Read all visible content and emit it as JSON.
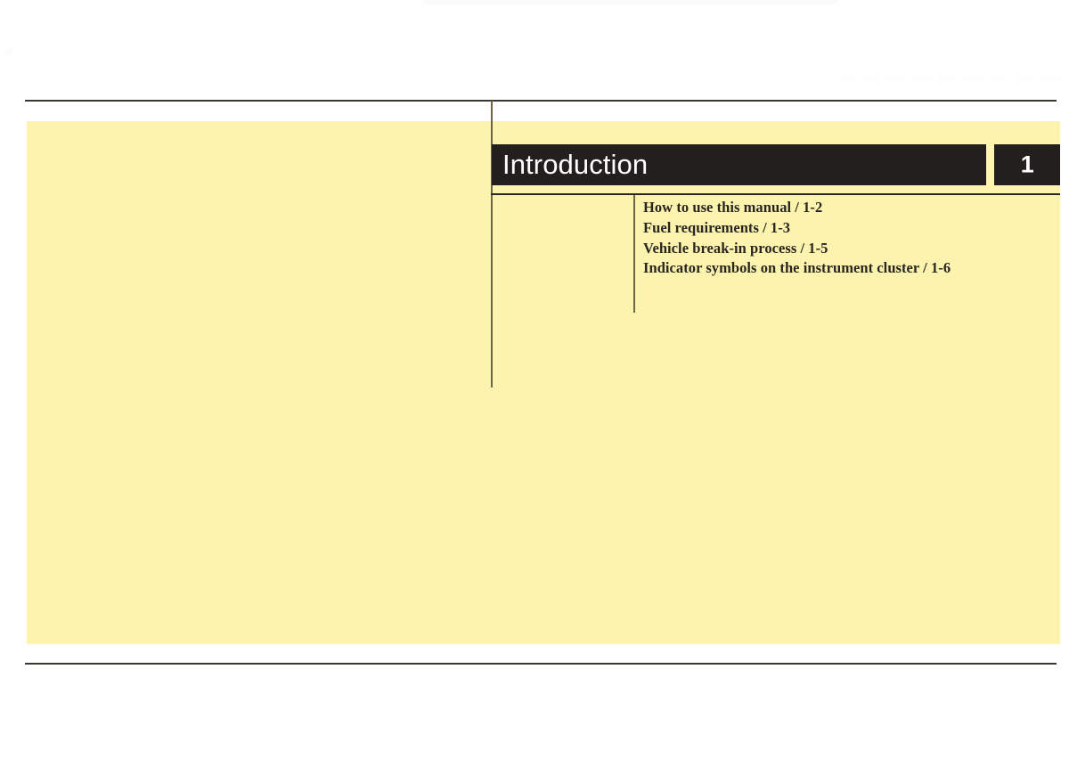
{
  "page": {
    "background_color": "#ffffff",
    "panel_color": "#fcf4ae",
    "rule_color": "#3b3733",
    "accent_dark": "#231f1f",
    "text_dark": "#2a2520"
  },
  "chapter": {
    "title": "Introduction",
    "number": "1"
  },
  "toc": {
    "items": [
      {
        "label": "How to use this manual / 1-2"
      },
      {
        "label": "Fuel requirements / 1-3"
      },
      {
        "label": "Vehicle break-in process / 1-5"
      },
      {
        "label": "Indicator symbols on the instrument cluster / 1-6"
      }
    ]
  }
}
